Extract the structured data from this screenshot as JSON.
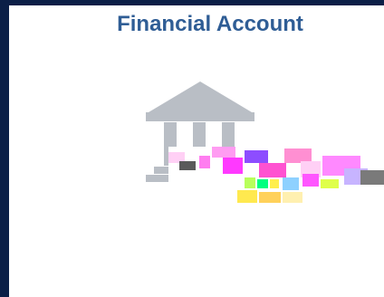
{
  "tile": {
    "title": "Financial Account",
    "icon": "bank-building-with-coins-icon"
  },
  "colors": {
    "frame": "#0b1f47",
    "title": "#2f5d95",
    "bank_gray": "#b9bec5",
    "coin_gold": "#e2b24a"
  }
}
